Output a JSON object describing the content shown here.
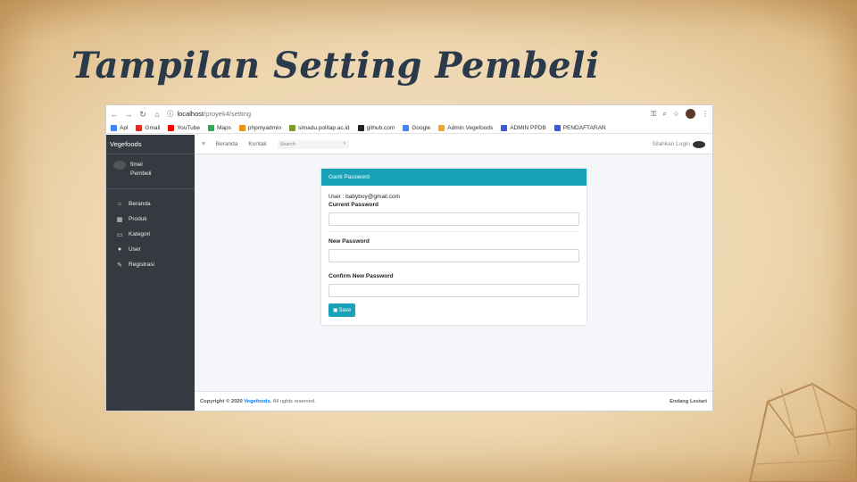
{
  "slide": {
    "title": "Tampilan Setting Pembeli"
  },
  "browser": {
    "url_host": "localhost",
    "url_path": "/proyek4/setting",
    "bookmarks": [
      "Apl",
      "Gmail",
      "YouTube",
      "Maps",
      "phpmyadmin",
      "simadu.politap.ac.id",
      "github.com",
      "Google",
      "Admin Vegefoods",
      "ADMIN PPDB",
      "PENDAFTARAN"
    ]
  },
  "sidebar": {
    "brand": "Vegefoods",
    "user_name_line1": "fimel",
    "user_name_line2": "Pembeli",
    "items": [
      {
        "label": "Beranda",
        "icon": "home-icon",
        "glyph": "⌂"
      },
      {
        "label": "Produk",
        "icon": "calendar-icon",
        "glyph": "▦"
      },
      {
        "label": "Kategori",
        "icon": "image-icon",
        "glyph": "▭"
      },
      {
        "label": "User",
        "icon": "user-icon",
        "glyph": "●"
      },
      {
        "label": "Registrasi",
        "icon": "edit-icon",
        "glyph": "✎"
      }
    ]
  },
  "topnav": {
    "menu_glyph": "≡",
    "links": [
      "Beranda",
      "Kontak"
    ],
    "search_placeholder": "Search",
    "login_label": "Silahkan Login"
  },
  "card": {
    "header": "Ganti Password",
    "user_line": "User : babyboy@gmail.com",
    "current_label": "Current Password",
    "new_label": "New Password",
    "confirm_label": "Confirm New Password",
    "save_label": "Save"
  },
  "footer": {
    "copyright_prefix": "Copyright © 2020 ",
    "brand": "Vegefoods.",
    "suffix": " All rights reserved.",
    "author": "Endang Lestari"
  },
  "colors": {
    "accent": "#17a2b8",
    "sidebar": "#343a40",
    "title": "#2b3a4a"
  }
}
